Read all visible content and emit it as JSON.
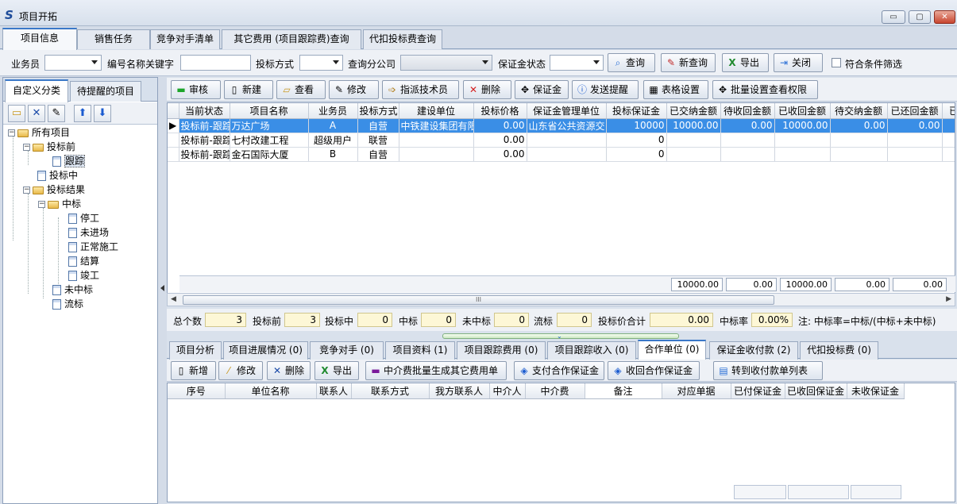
{
  "window": {
    "title": "项目开拓",
    "controls": {
      "minimize": "▭",
      "restore": "▢",
      "close": "✕"
    }
  },
  "top_tabs": [
    "项目信息",
    "销售任务",
    "竞争对手清单",
    "其它费用 (项目跟踪费)查询",
    "代扣投标费查询"
  ],
  "query": {
    "salesperson_label": "业务员",
    "keyword_label": "编号名称关键字",
    "bid_method_label": "投标方式",
    "branch_label": "查询分公司",
    "deposit_status_label": "保证金状态",
    "search_btn": "查询",
    "new_query_btn": "新查询",
    "export_btn": "导出",
    "close_btn": "关闭",
    "filter_label": "符合条件筛选"
  },
  "left_tabs": [
    "自定义分类",
    "待提醒的项目"
  ],
  "tree": {
    "root": "所有项目",
    "pre_bid": "投标前",
    "tracking": "跟踪",
    "bidding": "投标中",
    "results": "投标结果",
    "won": "中标",
    "stopped": "停工",
    "not_entered": "未进场",
    "normal": "正常施工",
    "settlement": "结算",
    "completed": "竣工",
    "lost": "未中标",
    "failed": "流标"
  },
  "action_buttons": [
    "审核",
    "新建",
    "查看",
    "修改",
    "指派技术员",
    "删除",
    "保证金",
    "发送提醒",
    "表格设置",
    "批量设置查看权限"
  ],
  "grid": {
    "columns": [
      "当前状态",
      "项目名称",
      "业务员",
      "投标方式",
      "建设单位",
      "投标价格",
      "保证金管理单位",
      "投标保证金",
      "已交纳金额",
      "待收回金额",
      "已收回金额",
      "待交纳金额",
      "已还回金额",
      "已"
    ],
    "rows": [
      [
        "投标前-跟踪",
        "万达广场",
        "A",
        "自营",
        "中铁建设集团有限",
        "0.00",
        "山东省公共资源交",
        "10000",
        "10000.00",
        "0.00",
        "10000.00",
        "0.00",
        "0.00",
        ""
      ],
      [
        "投标前-跟踪",
        "七村改建工程",
        "超级用户",
        "联营",
        "",
        "0.00",
        "",
        "0",
        "",
        "",
        "",
        "",
        "",
        ""
      ],
      [
        "投标前-跟踪",
        "金石国际大厦",
        "B",
        "自营",
        "",
        "0.00",
        "",
        "0",
        "",
        "",
        "",
        "",
        "",
        ""
      ]
    ],
    "totals": [
      "10000.00",
      "0.00",
      "10000.00",
      "0.00",
      "0.00"
    ],
    "scroll_label": "III"
  },
  "stats": {
    "total_label": "总个数",
    "total": "3",
    "pre_label": "投标前",
    "pre": "3",
    "mid_label": "投标中",
    "mid": "0",
    "won_label": "中标",
    "won": "0",
    "lost_label": "未中标",
    "lost": "0",
    "failed_label": "流标",
    "failed": "0",
    "price_label": "投标价合计",
    "price": "0.00",
    "rate_label": "中标率",
    "rate": "0.00%",
    "note": "注: 中标率=中标/(中标+未中标)"
  },
  "bottom_tabs": [
    "项目分析",
    "项目进展情况 (0)",
    "竞争对手 (0)",
    "项目资料 (1)",
    "项目跟踪费用 (0)",
    "项目跟踪收入 (0)",
    "合作单位 (0)",
    "保证金收付款 (2)",
    "代扣投标费 (0)"
  ],
  "bottom_buttons": [
    "新增",
    "修改",
    "删除",
    "导出",
    "中介费批量生成其它费用单",
    "支付合作保证金",
    "收回合作保证金",
    "转到收付款单列表"
  ],
  "bottom_grid": {
    "columns": [
      "序号",
      "单位名称",
      "联系人",
      "联系方式",
      "我方联系人",
      "中介人",
      "中介费",
      "备注",
      "对应单据",
      "已付保证金",
      "已收回保证金",
      "未收保证金"
    ]
  },
  "colors": {
    "selection": "#3a8ee6",
    "accent_tab": "#3a78c8",
    "stat_bg": "#fdf7d6"
  }
}
